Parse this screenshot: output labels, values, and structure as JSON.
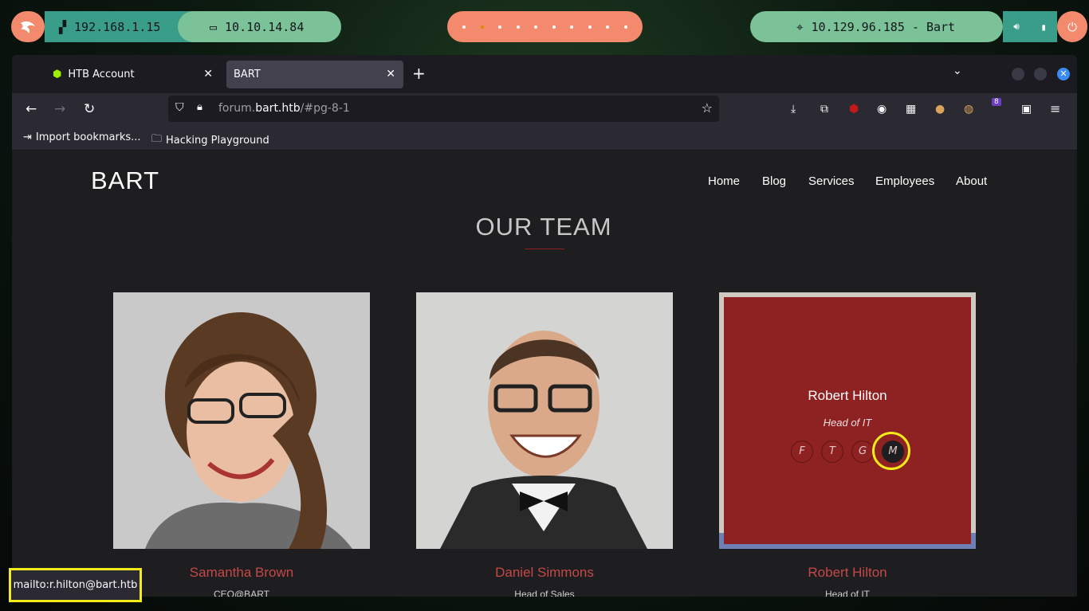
{
  "panel": {
    "local_ip": "192.168.1.15",
    "vpn_ip": "10.10.14.84",
    "target": "10.129.96.185 - Bart",
    "icons": [
      "kali-dragon-icon",
      "network-icon",
      "laptop-icon",
      "crosshair-icon",
      "volume-icon",
      "battery-icon",
      "power-icon"
    ]
  },
  "browser": {
    "tabs": [
      {
        "label": "HTB Account"
      },
      {
        "label": "BART"
      }
    ],
    "url_prefix": "forum.",
    "url_domain": "bart.htb",
    "url_suffix": "/#pg-8-1",
    "bookmarks": [
      "Import bookmarks...",
      "Hacking Playground"
    ],
    "extension_badge": "8"
  },
  "site": {
    "brand": "BART",
    "nav": [
      "Home",
      "Blog",
      "Services",
      "Employees",
      "About"
    ],
    "section_title": "OUR TEAM",
    "team": [
      {
        "name": "Samantha Brown",
        "role": "CEO@BART"
      },
      {
        "name": "Daniel Simmons",
        "role": "Head of Sales"
      },
      {
        "name": "Robert Hilton",
        "role": "Head of IT"
      }
    ],
    "overlay": {
      "name": "Robert Hilton",
      "role": "Head of IT",
      "social": [
        "F",
        "T",
        "G",
        "M"
      ]
    }
  },
  "status_bar": "mailto:r.hilton@bart.htb",
  "colors": {
    "accent": "#c44848",
    "overlay": "#8e2121",
    "highlight": "#f4ec1a"
  }
}
